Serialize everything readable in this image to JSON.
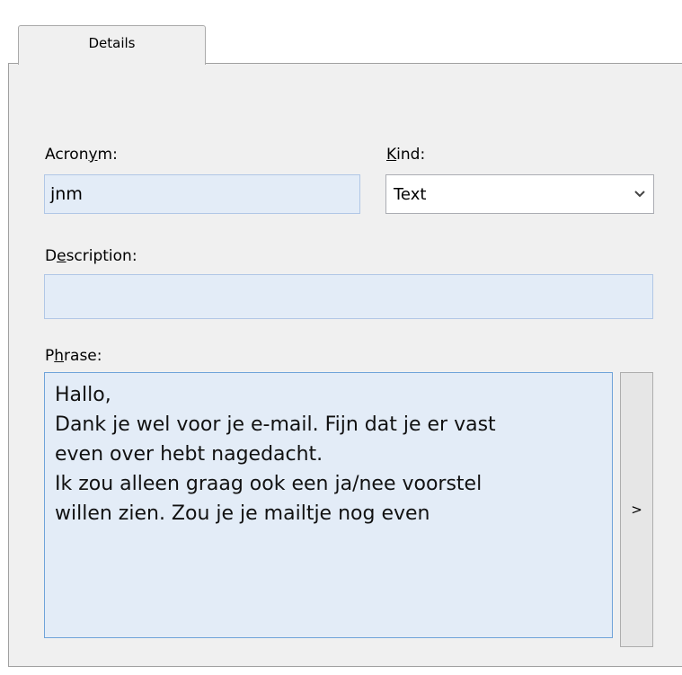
{
  "tab": {
    "label": "Details"
  },
  "acronym": {
    "label_pre": "Acron",
    "label_key": "y",
    "label_post": "m:",
    "value": "jnm"
  },
  "kind": {
    "label_key": "K",
    "label_post": "ind:",
    "value": "Text"
  },
  "description": {
    "label_pre": "D",
    "label_key": "e",
    "label_post": "scription:",
    "value": ""
  },
  "phrase": {
    "label_pre": "P",
    "label_key": "h",
    "label_post": "rase:",
    "lines": [
      "Hallo,",
      "",
      "Dank je wel voor je e-mail. Fijn dat je er vast",
      "even over hebt nagedacht.",
      "",
      "Ik zou alleen graag ook een ja/nee voorstel",
      "willen zien. Zou je je mailtje nog even"
    ]
  },
  "side_button": {
    "label": ">"
  }
}
